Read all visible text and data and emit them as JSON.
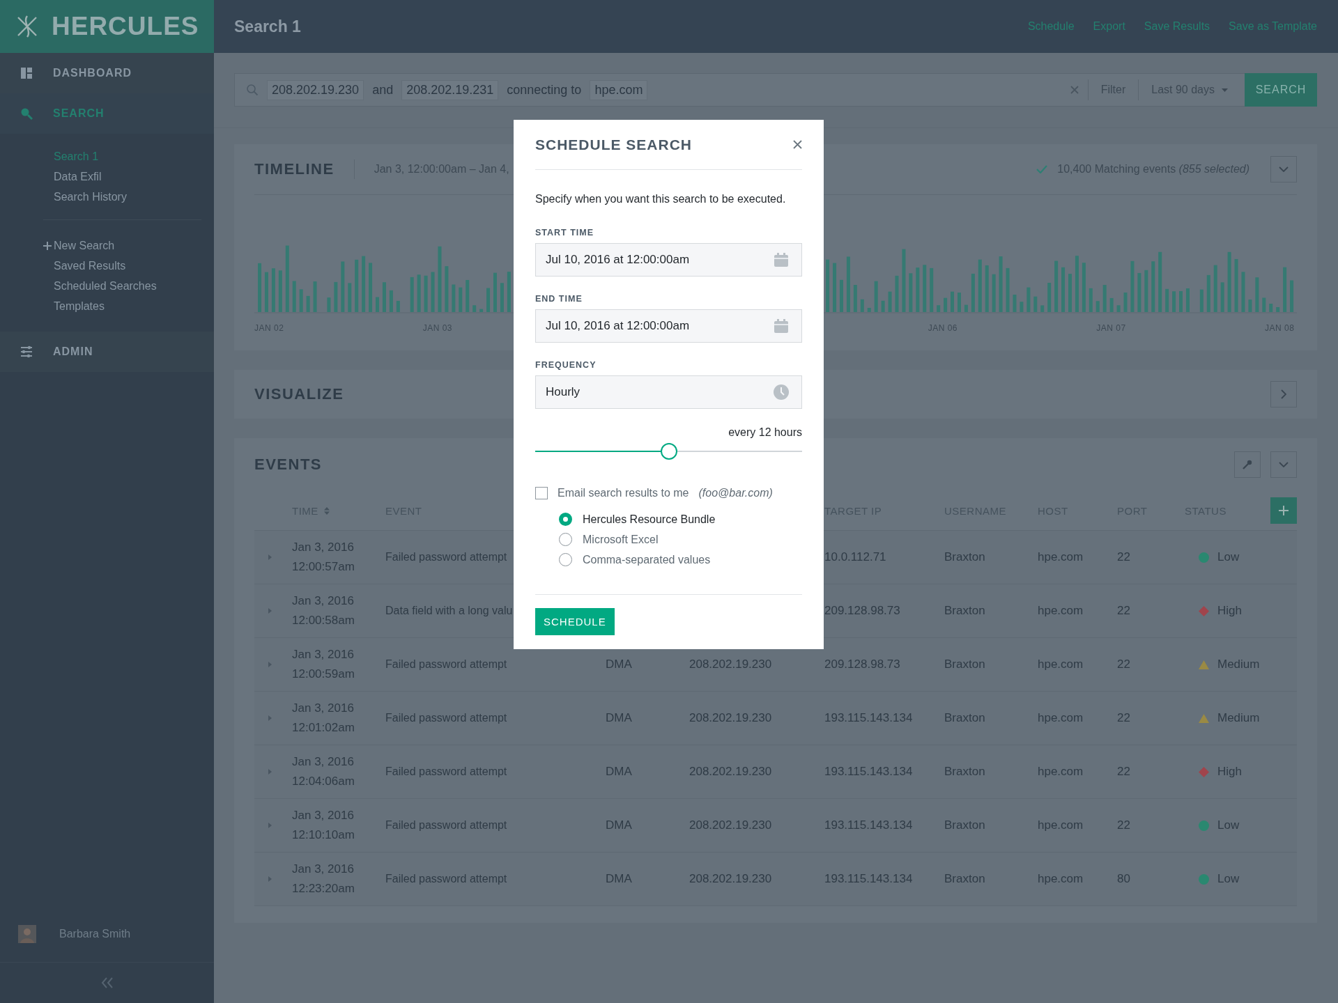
{
  "brand": {
    "name": "HERCULES"
  },
  "header": {
    "title": "Search 1",
    "actions": [
      "Schedule",
      "Export",
      "Save Results",
      "Save as Template"
    ]
  },
  "nav": [
    {
      "label": "DASHBOARD",
      "kind": "dashboard",
      "selected": false
    },
    {
      "label": "SEARCH",
      "kind": "search",
      "selected": true,
      "groups": [
        [
          {
            "label": "Search 1",
            "selected": true
          },
          {
            "label": "Data Exfil",
            "selected": false
          },
          {
            "label": "Search History",
            "selected": false
          }
        ],
        [
          {
            "label": "New Search",
            "kind": "add",
            "selected": false
          },
          {
            "label": "Saved Results",
            "selected": false
          },
          {
            "label": "Scheduled Searches",
            "selected": false
          },
          {
            "label": "Templates",
            "selected": false
          }
        ]
      ]
    },
    {
      "label": "ADMIN",
      "kind": "admin",
      "selected": false
    }
  ],
  "user": {
    "name": "Barbara Smith"
  },
  "query": {
    "tokens": [
      {
        "text": "208.202.19.230",
        "kind": "term"
      },
      {
        "text": "and",
        "kind": "operator"
      },
      {
        "text": "208.202.19.231",
        "kind": "term"
      },
      {
        "text": "connecting to",
        "kind": "operator"
      },
      {
        "text": "hpe.com",
        "kind": "term"
      }
    ],
    "filter": "Filter",
    "range": "Last 90 days",
    "button": "SEARCH"
  },
  "timeline": {
    "title": "TIMELINE",
    "range": "Jan 3, 12:00:00am – Jan 4,",
    "summary": "10,400 Matching events *(855 selected)*",
    "axis_labels": [
      "JAN 02",
      "JAN 03",
      "JAN 06",
      "JAN 07",
      "JAN 08"
    ]
  },
  "visualize": {
    "title": "VISUALIZE"
  },
  "events": {
    "title": "EVENTS",
    "columns": {
      "time": "TIME",
      "event": "EVENT",
      "target_ip": "TARGET IP",
      "username": "USERNAME",
      "host": "HOST",
      "port": "PORT",
      "status": "STATUS"
    },
    "rows": [
      {
        "date": "Jan 3, 2016",
        "clock": "12:00:57am",
        "event": "Failed password attempt",
        "target_ip": "10.0.112.71",
        "username": "Braxton",
        "host": "hpe.com",
        "port": "22",
        "status": "Low",
        "kind": "low"
      },
      {
        "date": "Jan 3, 2016",
        "clock": "12:00:58am",
        "event": "Data field with a long valu",
        "target_ip": "209.128.98.73",
        "username": "Braxton",
        "host": "hpe.com",
        "port": "22",
        "status": "High",
        "kind": "high"
      },
      {
        "date": "Jan 3, 2016",
        "clock": "12:00:59am",
        "event": "Failed password attempt",
        "column_3": "DMA",
        "column_4": "208.202.19.230",
        "target_ip": "209.128.98.73",
        "username": "Braxton",
        "host": "hpe.com",
        "port": "22",
        "status": "Medium",
        "kind": "medium"
      },
      {
        "date": "Jan 3, 2016",
        "clock": "12:01:02am",
        "event": "Failed password attempt",
        "column_3": "DMA",
        "column_4": "208.202.19.230",
        "target_ip": "193.115.143.134",
        "username": "Braxton",
        "host": "hpe.com",
        "port": "22",
        "status": "Medium",
        "kind": "medium"
      },
      {
        "date": "Jan 3, 2016",
        "clock": "12:04:06am",
        "event": "Failed password attempt",
        "column_3": "DMA",
        "column_4": "208.202.19.230",
        "target_ip": "193.115.143.134",
        "username": "Braxton",
        "host": "hpe.com",
        "port": "22",
        "status": "High",
        "kind": "high"
      },
      {
        "date": "Jan 3, 2016",
        "clock": "12:10:10am",
        "event": "Failed password attempt",
        "column_3": "DMA",
        "column_4": "208.202.19.230",
        "target_ip": "193.115.143.134",
        "username": "Braxton",
        "host": "hpe.com",
        "port": "22",
        "status": "Low",
        "kind": "low"
      },
      {
        "date": "Jan 3, 2016",
        "clock": "12:23:20am",
        "event": "Failed password attempt",
        "column_3": "DMA",
        "column_4": "208.202.19.230",
        "target_ip": "193.115.143.134",
        "username": "Braxton",
        "host": "hpe.com",
        "port": "80",
        "status": "Low",
        "kind": "low"
      }
    ]
  },
  "modal": {
    "title": "SCHEDULE SEARCH",
    "intro": "Specify when you want this search to be executed.",
    "fields": [
      {
        "label": "START TIME",
        "value": "Jul 10, 2016 at 12:00:00am",
        "kind": "date"
      },
      {
        "label": "END TIME",
        "value": "Jul 10, 2016 at 12:00:00am",
        "kind": "date"
      },
      {
        "label": "FREQUENCY",
        "value": "Hourly",
        "kind": "time"
      }
    ],
    "interval": {
      "reading": "every 12 hours",
      "level": 0.5
    },
    "email": {
      "label": "Email search results to me",
      "address": "(foo@bar.com)",
      "checked": false
    },
    "formats": [
      {
        "label": "Hercules Resource Bundle",
        "selected": true
      },
      {
        "label": "Microsoft Excel",
        "selected": false
      },
      {
        "label": "Comma-separated values",
        "selected": false
      }
    ],
    "button": "SCHEDULE"
  }
}
